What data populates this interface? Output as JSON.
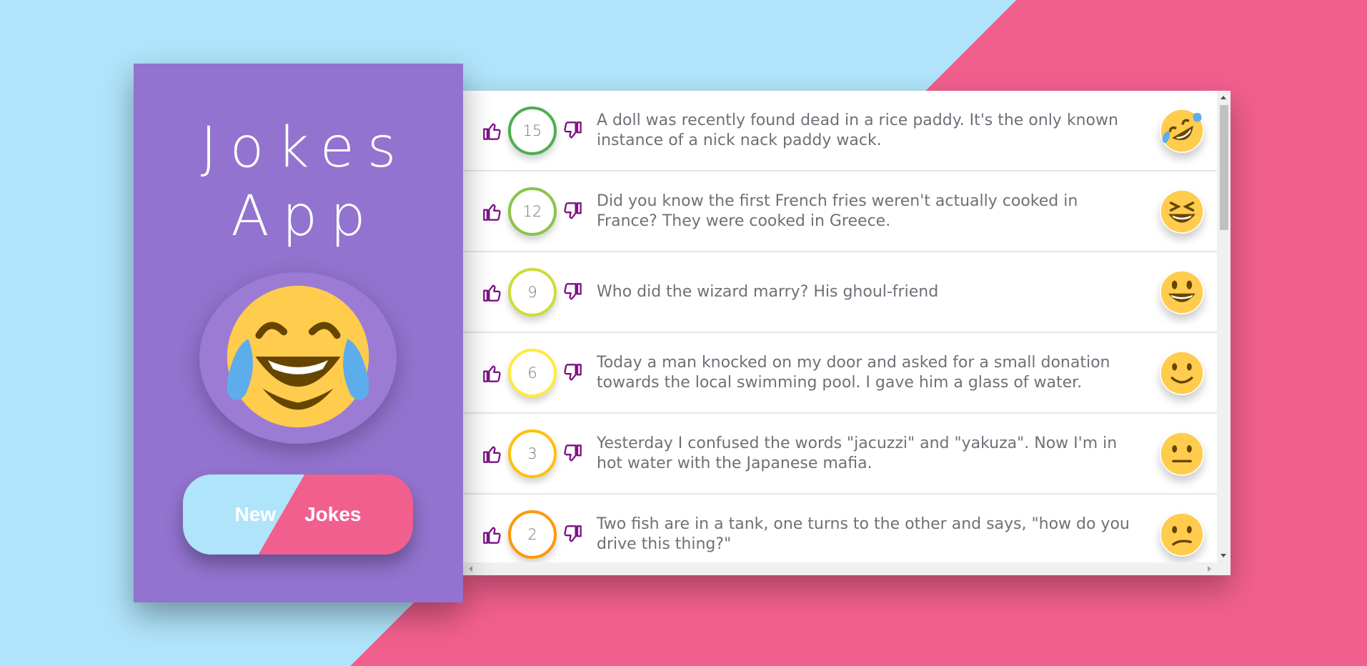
{
  "app": {
    "title_line1": "Jokes",
    "title_line2": "App",
    "hero_icon": "laughing-tears-emoji-icon"
  },
  "new_jokes_button": {
    "label_part1": "New",
    "label_part2": "Jokes"
  },
  "colors": {
    "sidebar_bg": "#9273cf",
    "accent_blue": "#b0e4fa",
    "accent_pink": "#f15f8e",
    "vote_icon": "#7b1385"
  },
  "jokes": [
    {
      "score": "15",
      "text": "A doll was recently found dead in a rice paddy. It's the only known instance of a nick nack paddy wack.",
      "border_color": "#4caf50",
      "emoji": "rolling-on-floor-laughing-icon"
    },
    {
      "score": "12",
      "text": "Did you know the first French fries weren't actually cooked in France? They were cooked in Greece.",
      "border_color": "#8bc34a",
      "emoji": "grinning-squinting-icon"
    },
    {
      "score": "9",
      "text": "Who did the wizard marry? His ghoul-friend",
      "border_color": "#cddc39",
      "emoji": "grinning-face-icon"
    },
    {
      "score": "6",
      "text": "Today a man knocked on my door and asked for a small donation towards the local swimming pool. I gave him a glass of water.",
      "border_color": "#ffeb3b",
      "emoji": "slightly-smiling-icon"
    },
    {
      "score": "3",
      "text": "Yesterday I confused the words \"jacuzzi\" and \"yakuza\". Now I'm in hot water with the Japanese mafia.",
      "border_color": "#ffc107",
      "emoji": "neutral-face-icon"
    },
    {
      "score": "2",
      "text": "Two fish are in a tank, one turns to the other and says, \"how do you drive this thing?\"",
      "border_color": "#ff9800",
      "emoji": "confused-face-icon"
    }
  ]
}
